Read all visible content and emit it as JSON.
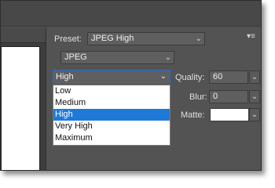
{
  "preset": {
    "label": "Preset:",
    "value": "JPEG High"
  },
  "format": {
    "value": "JPEG"
  },
  "quality_level": {
    "value": "High",
    "options": [
      "Low",
      "Medium",
      "High",
      "Very High",
      "Maximum"
    ],
    "selected_index": 2
  },
  "quality": {
    "label": "Quality:",
    "value": "60"
  },
  "blur": {
    "label": "Blur:",
    "value": "0"
  },
  "matte": {
    "label": "Matte:",
    "color": "#ffffff"
  },
  "icons": {
    "panel_menu": "panel-menu-icon",
    "chevron": "chevron-down-icon"
  }
}
